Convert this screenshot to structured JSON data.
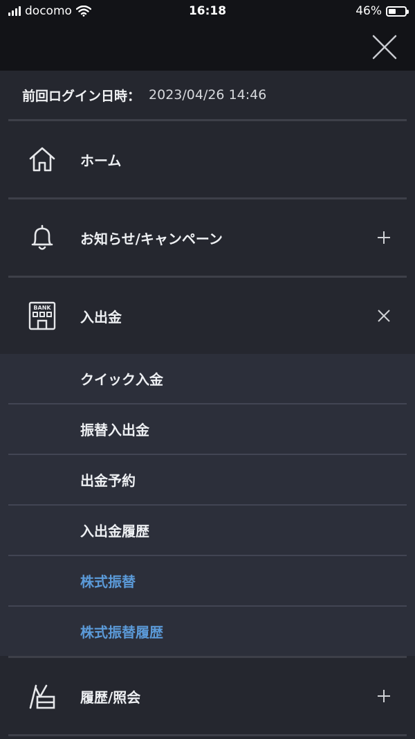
{
  "status_bar": {
    "carrier": "docomo",
    "time": "16:18",
    "battery_percent": "46%",
    "battery_level": 0.46
  },
  "header": {
    "close_icon": "close-icon"
  },
  "login": {
    "label": "前回ログイン日時：",
    "value": "2023/04/26 14:46"
  },
  "menu": {
    "home": {
      "label": "ホーム",
      "icon": "home-icon"
    },
    "news": {
      "label": "お知らせ/キャンペーン",
      "icon": "bell-icon",
      "toggle": "plus-icon"
    },
    "deposit": {
      "label": "入出金",
      "icon": "bank-icon",
      "toggle": "close-icon"
    },
    "deposit_items": [
      {
        "label": "クイック入金"
      },
      {
        "label": "振替入出金"
      },
      {
        "label": "出金予約"
      },
      {
        "label": "入出金履歴"
      },
      {
        "label": "株式振替",
        "color": "#5b9ad8"
      },
      {
        "label": "株式振替履歴",
        "color": "#5b9ad8"
      }
    ],
    "history": {
      "label": "履歴/照会",
      "icon": "history-icon",
      "toggle": "plus-icon"
    }
  },
  "colors": {
    "background": "#25272f",
    "header": "#121317",
    "submenu_bg": "#2c2f3a",
    "accent_link": "#5b9ad8"
  }
}
